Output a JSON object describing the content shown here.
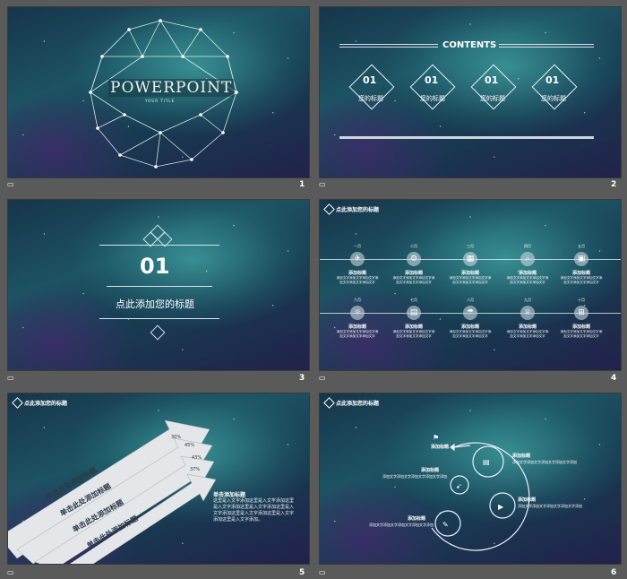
{
  "slides": [
    {
      "number": "1",
      "title": "POWERPOINT",
      "subtitle": "YOUR TITLE"
    },
    {
      "number": "2",
      "contents": "CONTENTS",
      "items": [
        {
          "num": "01",
          "label": "您的标题"
        },
        {
          "num": "01",
          "label": "您的标题"
        },
        {
          "num": "01",
          "label": "您的标题"
        },
        {
          "num": "01",
          "label": "您的标题"
        }
      ]
    },
    {
      "number": "3",
      "section_num": "01",
      "section_title": "点此添加您的标题"
    },
    {
      "number": "4",
      "header": "点此添加您的标题",
      "months_top": [
        "一月",
        "二月",
        "三月",
        "四月",
        "五月"
      ],
      "months_bottom": [
        "六月",
        "七月",
        "八月",
        "九月",
        "十月"
      ],
      "item_title": "添加标题",
      "item_text": "添加文字添加文字添加文字添加文字添加文字添加文字"
    },
    {
      "number": "5",
      "header": "点此添加您的标题",
      "arrows": [
        "单击此处添加标题",
        "单击此处添加标题",
        "单击此处添加标题",
        "单击此处添加标题"
      ],
      "percents": [
        "30%",
        "45%",
        "43%",
        "37%"
      ],
      "text_title": "单击添加标题",
      "text_body": "这里是入文字添加这里是入文字添加这里是入文字添加这里是入文字添加这里是入文字添加这里是入文字添加这里是入文字添加这里是入文字添加。"
    },
    {
      "number": "6",
      "header": "点此添加您的标题",
      "block_title": "添加标题",
      "block_text": "添加文字添加文字添加文字添加文字添加"
    }
  ],
  "notes_icon": "comment-icon"
}
